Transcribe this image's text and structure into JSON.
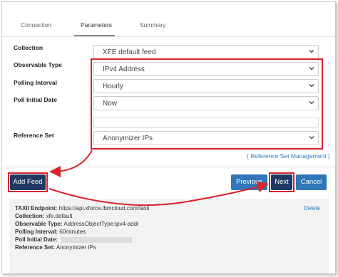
{
  "tabs": [
    "Connection",
    "Parameters",
    "Summary"
  ],
  "active_tab": "Parameters",
  "form": {
    "collection": {
      "label": "Collection",
      "value": "XFE default feed"
    },
    "observable_type": {
      "label": "Observable Type",
      "value": "IPv4 Address"
    },
    "polling_interval": {
      "label": "Polling Interval",
      "value": "Hourly"
    },
    "poll_initial_date": {
      "label": "Poll Initial Date",
      "value": "Now"
    },
    "reference_set": {
      "label": "Reference Set",
      "value": "Anonymizer IPs"
    }
  },
  "reference_set_link": "( Reference Set Management )",
  "buttons": {
    "add_feed": "Add Feed",
    "previous": "Previous",
    "next": "Next",
    "cancel": "Cancel"
  },
  "summary": {
    "delete_label": "Delete",
    "lines": [
      {
        "key": "TAXII Endpoint:",
        "value": "https://api.xforce.ibmcloud.com/taxii"
      },
      {
        "key": "Collection:",
        "value": "xfe.default"
      },
      {
        "key": "Observable Type:",
        "value": "AddressObjectType:ipv4-addr"
      },
      {
        "key": "Polling Interval:",
        "value": "60minutes"
      },
      {
        "key": "Poll Initial Date:",
        "value": ""
      },
      {
        "key": "Reference Set:",
        "value": "Anonymizer IPs"
      }
    ]
  },
  "colors": {
    "annotation_red": "#d9232d",
    "primary_dark": "#1f3a64",
    "primary_blue": "#2f77b8",
    "link": "#2e7cbf"
  }
}
